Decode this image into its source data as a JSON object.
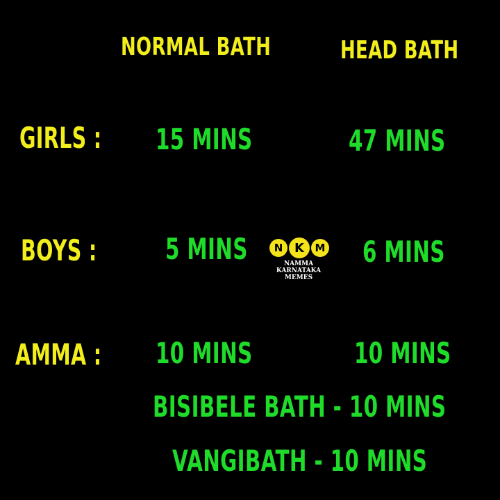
{
  "headers": {
    "normal_bath": "NORMAL BATH",
    "head_bath": "HEAD BATH"
  },
  "rows": [
    {
      "label": "GIRLS :",
      "normal": "15 MINS",
      "head": "47 MINS"
    },
    {
      "label": "BOYS :",
      "normal": "5 MINS",
      "head": "6 MINS"
    },
    {
      "label": "AMMA :",
      "normal": "10 MINS",
      "head": "10 MINS"
    }
  ],
  "extras": [
    "BISIBELE BATH - 10 MINS",
    "VANGIBATH - 10 MINS"
  ],
  "logo": {
    "letters": [
      "N",
      "K",
      "M"
    ],
    "line1": "NAMMA",
    "line2": "KARNATAKA",
    "line3": "MEMES"
  },
  "colors": {
    "background": "#000000",
    "header_text": "#f2ee1c",
    "value_text": "#1fdc2a",
    "logo_circle": "#f4e31a"
  }
}
